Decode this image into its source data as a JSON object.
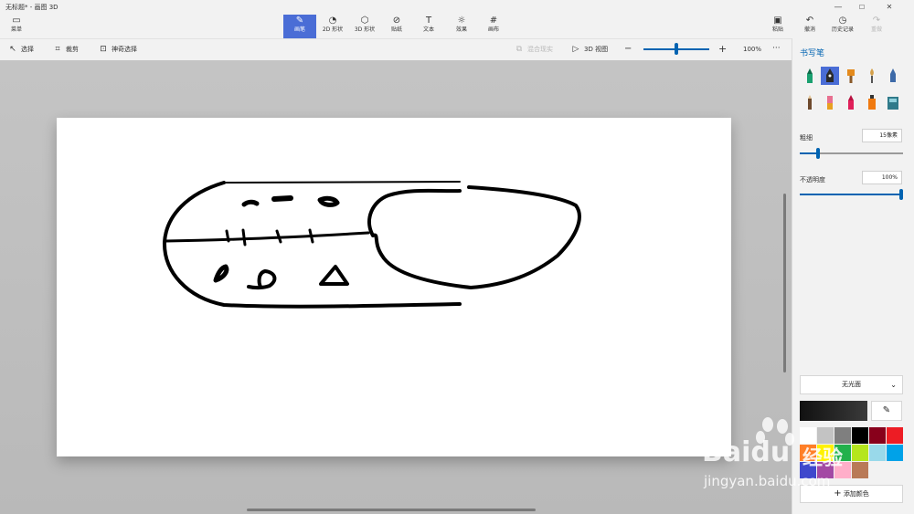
{
  "window": {
    "title": "无标题* - 画图 3D",
    "controls": [
      "—",
      "☐",
      "✕"
    ]
  },
  "menu": {
    "label": "菜单"
  },
  "toolbar": {
    "tabs": [
      {
        "label": "画笔",
        "icon": "brushes-icon"
      },
      {
        "label": "2D 形状",
        "icon": "2d-shapes-icon"
      },
      {
        "label": "3D 形状",
        "icon": "3d-shapes-icon"
      },
      {
        "label": "贴纸",
        "icon": "stickers-icon"
      },
      {
        "label": "文本",
        "icon": "text-icon"
      },
      {
        "label": "效果",
        "icon": "effects-icon"
      },
      {
        "label": "画布",
        "icon": "canvas-icon"
      }
    ],
    "active_tab": "画笔",
    "right": [
      {
        "label": "粘贴",
        "icon": "paste-icon"
      },
      {
        "label": "撤消",
        "icon": "undo-icon"
      },
      {
        "label": "历史记录",
        "icon": "history-icon"
      },
      {
        "label": "重做",
        "icon": "redo-icon",
        "disabled": true
      }
    ]
  },
  "commandbar": {
    "select": "选择",
    "crop": "裁剪",
    "magic_select": "神奇选择",
    "mixed_reality": "混合现实",
    "view3d": "3D 视图",
    "zoom": "100%",
    "zoom_level": 0.5,
    "more": "···"
  },
  "panel": {
    "title": "书写笔",
    "brushes": [
      "marker",
      "calligraphy-pen",
      "oil-brush",
      "watercolor",
      "pencil",
      "eraser",
      "crayon",
      "pixel-pen",
      "spray-can",
      "fill"
    ],
    "selected_brush": "calligraphy-pen",
    "thickness_label": "粗细",
    "thickness_value": "15像素",
    "thickness_level": 0.18,
    "opacity_label": "不透明度",
    "opacity_value": "100%",
    "opacity_level": 1.0,
    "finish": "无光面",
    "current_color": "#111111",
    "add_color": "添加颜色",
    "palette": [
      "#ffffff",
      "#c3c3c3",
      "#7f7f7f",
      "#000000",
      "#88001b",
      "#ed1c24",
      "#ff7f27",
      "#fff200",
      "#22b14c",
      "#b5e61d",
      "#99d9ea",
      "#00a2e8",
      "#3f48cc",
      "#a349a4",
      "#ffaec9",
      "#b97a57"
    ]
  },
  "watermark": {
    "brand": "Bai",
    "brand2": "du",
    "cn": "经验",
    "url": "jingyan.baidu.com"
  }
}
